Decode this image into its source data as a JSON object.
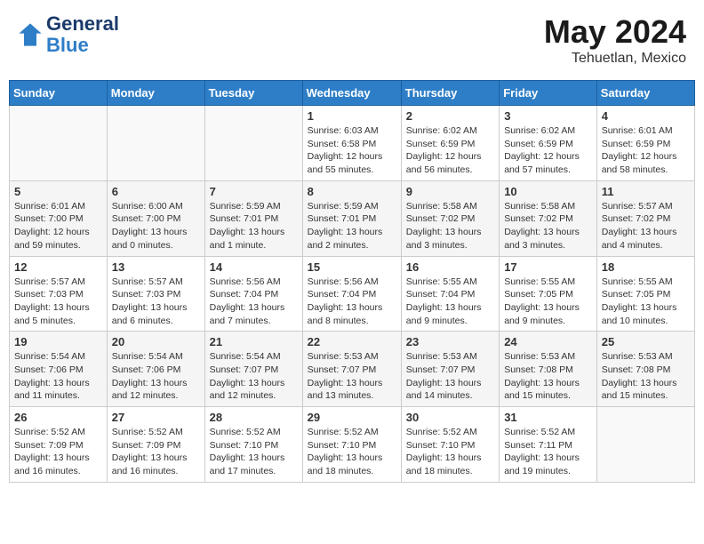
{
  "header": {
    "logo_general": "General",
    "logo_blue": "Blue",
    "month": "May 2024",
    "location": "Tehuetlan, Mexico"
  },
  "weekdays": [
    "Sunday",
    "Monday",
    "Tuesday",
    "Wednesday",
    "Thursday",
    "Friday",
    "Saturday"
  ],
  "weeks": [
    [
      {
        "day": "",
        "content": ""
      },
      {
        "day": "",
        "content": ""
      },
      {
        "day": "",
        "content": ""
      },
      {
        "day": "1",
        "content": "Sunrise: 6:03 AM\nSunset: 6:58 PM\nDaylight: 12 hours\nand 55 minutes."
      },
      {
        "day": "2",
        "content": "Sunrise: 6:02 AM\nSunset: 6:59 PM\nDaylight: 12 hours\nand 56 minutes."
      },
      {
        "day": "3",
        "content": "Sunrise: 6:02 AM\nSunset: 6:59 PM\nDaylight: 12 hours\nand 57 minutes."
      },
      {
        "day": "4",
        "content": "Sunrise: 6:01 AM\nSunset: 6:59 PM\nDaylight: 12 hours\nand 58 minutes."
      }
    ],
    [
      {
        "day": "5",
        "content": "Sunrise: 6:01 AM\nSunset: 7:00 PM\nDaylight: 12 hours\nand 59 minutes."
      },
      {
        "day": "6",
        "content": "Sunrise: 6:00 AM\nSunset: 7:00 PM\nDaylight: 13 hours\nand 0 minutes."
      },
      {
        "day": "7",
        "content": "Sunrise: 5:59 AM\nSunset: 7:01 PM\nDaylight: 13 hours\nand 1 minute."
      },
      {
        "day": "8",
        "content": "Sunrise: 5:59 AM\nSunset: 7:01 PM\nDaylight: 13 hours\nand 2 minutes."
      },
      {
        "day": "9",
        "content": "Sunrise: 5:58 AM\nSunset: 7:02 PM\nDaylight: 13 hours\nand 3 minutes."
      },
      {
        "day": "10",
        "content": "Sunrise: 5:58 AM\nSunset: 7:02 PM\nDaylight: 13 hours\nand 3 minutes."
      },
      {
        "day": "11",
        "content": "Sunrise: 5:57 AM\nSunset: 7:02 PM\nDaylight: 13 hours\nand 4 minutes."
      }
    ],
    [
      {
        "day": "12",
        "content": "Sunrise: 5:57 AM\nSunset: 7:03 PM\nDaylight: 13 hours\nand 5 minutes."
      },
      {
        "day": "13",
        "content": "Sunrise: 5:57 AM\nSunset: 7:03 PM\nDaylight: 13 hours\nand 6 minutes."
      },
      {
        "day": "14",
        "content": "Sunrise: 5:56 AM\nSunset: 7:04 PM\nDaylight: 13 hours\nand 7 minutes."
      },
      {
        "day": "15",
        "content": "Sunrise: 5:56 AM\nSunset: 7:04 PM\nDaylight: 13 hours\nand 8 minutes."
      },
      {
        "day": "16",
        "content": "Sunrise: 5:55 AM\nSunset: 7:04 PM\nDaylight: 13 hours\nand 9 minutes."
      },
      {
        "day": "17",
        "content": "Sunrise: 5:55 AM\nSunset: 7:05 PM\nDaylight: 13 hours\nand 9 minutes."
      },
      {
        "day": "18",
        "content": "Sunrise: 5:55 AM\nSunset: 7:05 PM\nDaylight: 13 hours\nand 10 minutes."
      }
    ],
    [
      {
        "day": "19",
        "content": "Sunrise: 5:54 AM\nSunset: 7:06 PM\nDaylight: 13 hours\nand 11 minutes."
      },
      {
        "day": "20",
        "content": "Sunrise: 5:54 AM\nSunset: 7:06 PM\nDaylight: 13 hours\nand 12 minutes."
      },
      {
        "day": "21",
        "content": "Sunrise: 5:54 AM\nSunset: 7:07 PM\nDaylight: 13 hours\nand 12 minutes."
      },
      {
        "day": "22",
        "content": "Sunrise: 5:53 AM\nSunset: 7:07 PM\nDaylight: 13 hours\nand 13 minutes."
      },
      {
        "day": "23",
        "content": "Sunrise: 5:53 AM\nSunset: 7:07 PM\nDaylight: 13 hours\nand 14 minutes."
      },
      {
        "day": "24",
        "content": "Sunrise: 5:53 AM\nSunset: 7:08 PM\nDaylight: 13 hours\nand 15 minutes."
      },
      {
        "day": "25",
        "content": "Sunrise: 5:53 AM\nSunset: 7:08 PM\nDaylight: 13 hours\nand 15 minutes."
      }
    ],
    [
      {
        "day": "26",
        "content": "Sunrise: 5:52 AM\nSunset: 7:09 PM\nDaylight: 13 hours\nand 16 minutes."
      },
      {
        "day": "27",
        "content": "Sunrise: 5:52 AM\nSunset: 7:09 PM\nDaylight: 13 hours\nand 16 minutes."
      },
      {
        "day": "28",
        "content": "Sunrise: 5:52 AM\nSunset: 7:10 PM\nDaylight: 13 hours\nand 17 minutes."
      },
      {
        "day": "29",
        "content": "Sunrise: 5:52 AM\nSunset: 7:10 PM\nDaylight: 13 hours\nand 18 minutes."
      },
      {
        "day": "30",
        "content": "Sunrise: 5:52 AM\nSunset: 7:10 PM\nDaylight: 13 hours\nand 18 minutes."
      },
      {
        "day": "31",
        "content": "Sunrise: 5:52 AM\nSunset: 7:11 PM\nDaylight: 13 hours\nand 19 minutes."
      },
      {
        "day": "",
        "content": ""
      }
    ]
  ]
}
